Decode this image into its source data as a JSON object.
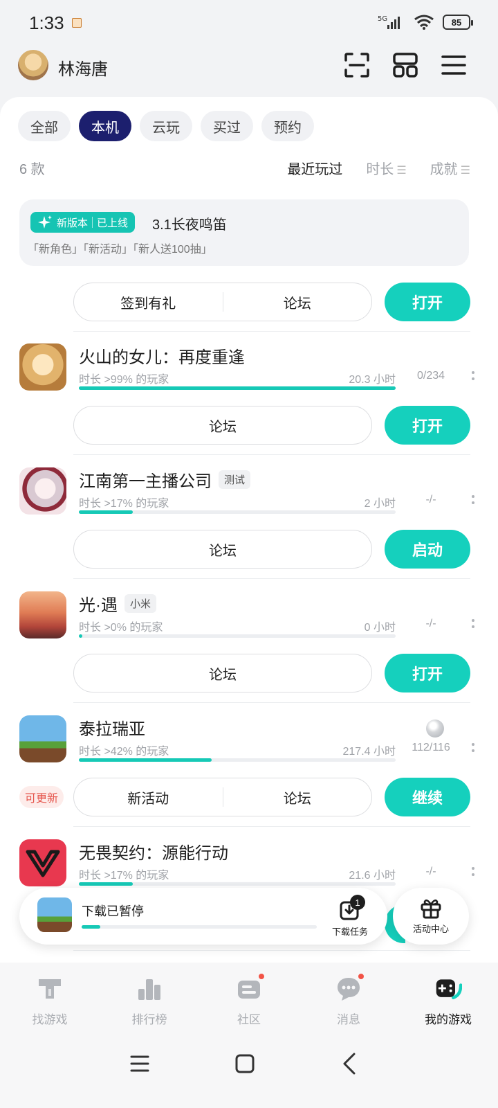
{
  "status": {
    "time": "1:33",
    "network": "5G",
    "battery": "85"
  },
  "header": {
    "user_name": "林海唐"
  },
  "filters": {
    "tabs": [
      {
        "label": "全部",
        "active": false
      },
      {
        "label": "本机",
        "active": true
      },
      {
        "label": "云玩",
        "active": false
      },
      {
        "label": "买过",
        "active": false
      },
      {
        "label": "预约",
        "active": false
      }
    ]
  },
  "summary": {
    "count": "6 款"
  },
  "sort": {
    "recent": "最近玩过",
    "duration": "时长",
    "achievement": "成就"
  },
  "promo": {
    "badge_left": "新版本",
    "badge_right": "已上线",
    "title": "3.1长夜鸣笛",
    "tags": "「新角色」「新活动」「新人送100抽」",
    "buttons": [
      "签到有礼",
      "论坛"
    ],
    "primary": "打开"
  },
  "games": [
    {
      "title": "火山的女儿：再度重逢",
      "tag": "",
      "sub": "时长 >99% 的玩家",
      "hours": "20.3 小时",
      "achievement": "0/234",
      "progress": 1.0,
      "buttons": [
        "论坛"
      ],
      "primary": "打开",
      "update": ""
    },
    {
      "title": "江南第一主播公司",
      "tag": "测试",
      "sub": "时长 >17% 的玩家",
      "hours": "2 小时",
      "achievement": "-/-",
      "progress": 0.17,
      "buttons": [
        "论坛"
      ],
      "primary": "启动",
      "update": ""
    },
    {
      "title": "光·遇",
      "tag": "小米",
      "sub": "时长 >0% 的玩家",
      "hours": "0 小时",
      "achievement": "-/-",
      "progress": 0.01,
      "buttons": [
        "论坛"
      ],
      "primary": "打开",
      "update": ""
    },
    {
      "title": "泰拉瑞亚",
      "tag": "",
      "sub": "时长 >42% 的玩家",
      "hours": "217.4 小时",
      "achievement": "112/116",
      "progress": 0.42,
      "buttons": [
        "新活动",
        "论坛"
      ],
      "primary": "继续",
      "update": "可更新"
    },
    {
      "title": "无畏契约：源能行动",
      "tag": "",
      "sub": "时长 >17% 的玩家",
      "hours": "21.6 小时",
      "achievement": "-/-",
      "progress": 0.17
    }
  ],
  "download": {
    "status": "下载已暂停",
    "progress": 0.08,
    "task_label": "下载任务",
    "task_count": "1"
  },
  "activity": {
    "label": "活动中心"
  },
  "bottom_nav": [
    {
      "label": "找游戏",
      "icon": "find-game-icon",
      "active": false,
      "dot": false
    },
    {
      "label": "排行榜",
      "icon": "ranking-icon",
      "active": false,
      "dot": false
    },
    {
      "label": "社区",
      "icon": "community-icon",
      "active": false,
      "dot": true
    },
    {
      "label": "消息",
      "icon": "message-icon",
      "active": false,
      "dot": true
    },
    {
      "label": "我的游戏",
      "icon": "my-games-icon",
      "active": true,
      "dot": false
    }
  ],
  "colors": {
    "accent": "#15d0bd",
    "active_tab": "#1c1f6e",
    "update_red": "#e5544b"
  }
}
